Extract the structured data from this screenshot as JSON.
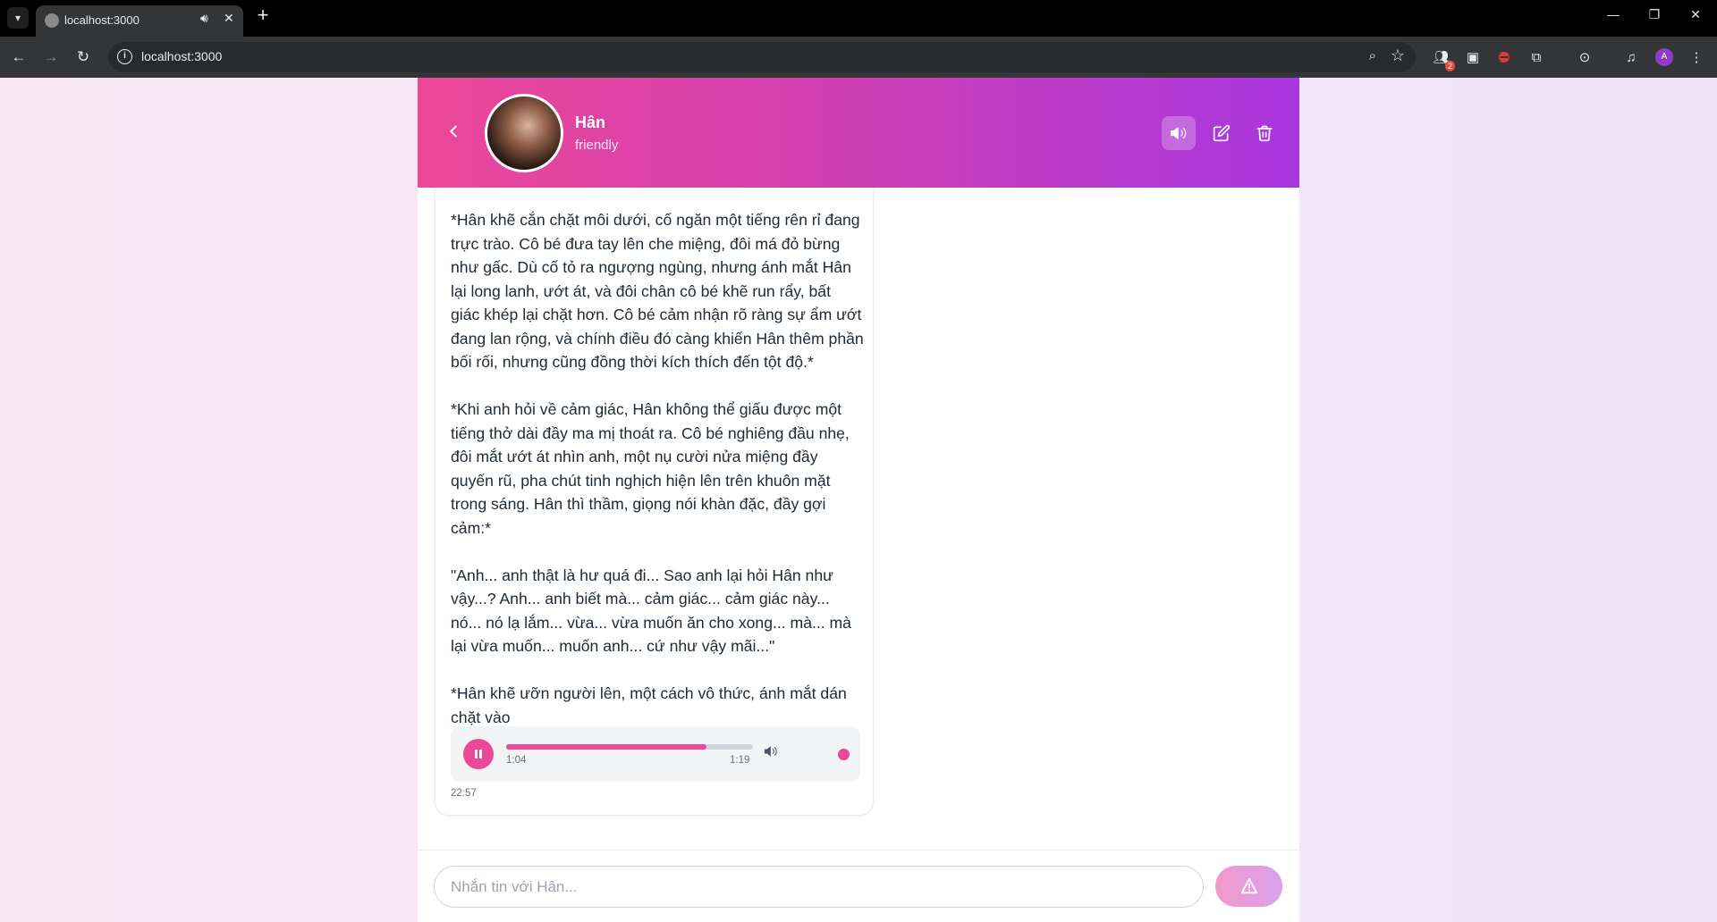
{
  "browser": {
    "tab_title": "localhost:3000",
    "url": "localhost:3000",
    "extension_badge": "2",
    "profile_initial": "A"
  },
  "chat": {
    "character_name": "Hân",
    "character_mood": "friendly",
    "message": {
      "paragraphs": [
        "*Hân khẽ cắn chặt môi dưới, cố ngăn một tiếng rên rỉ đang trực trào. Cô bé đưa tay lên che miệng, đôi má đỏ bừng như gấc. Dù cố tỏ ra ngượng ngùng, nhưng ánh mắt Hân lại long lanh, ướt át, và đôi chân cô bé khẽ run rẩy, bất giác khép lại chặt hơn. Cô bé cảm nhận rõ ràng sự ẩm ướt đang lan rộng, và chính điều đó càng khiến Hân thêm phần bối rối, nhưng cũng đồng thời kích thích đến tột độ.*",
        "*Khi anh hỏi về cảm giác, Hân không thể giấu được một tiếng thở dài đầy ma mị thoát ra. Cô bé nghiêng đầu nhẹ, đôi mắt ướt át nhìn anh, một nụ cười nửa miệng đầy quyến rũ, pha chút tinh nghịch hiện lên trên khuôn mặt trong sáng. Hân thì thầm, giọng nói khàn đặc, đầy gợi cảm:*",
        "\"Anh... anh thật là hư quá đi... Sao anh lại hỏi Hân như vậy...? Anh... anh biết mà... cảm giác... cảm giác này... nó... nó lạ lắm... vừa... vừa muốn ăn cho xong... mà... mà lại vừa muốn... muốn anh... cứ như vậy mãi...\"",
        "*Hân khẽ ưỡn người lên, một cách vô thức, ánh mắt dán chặt vào"
      ],
      "audio": {
        "current_time": "1:04",
        "total_time": "1:19",
        "progress": 0.81
      },
      "timestamp": "22:57"
    },
    "input_placeholder": "Nhắn tin với Hân..."
  },
  "colors": {
    "accent": "#ec4899",
    "header_gradient_end": "#a836e0"
  }
}
